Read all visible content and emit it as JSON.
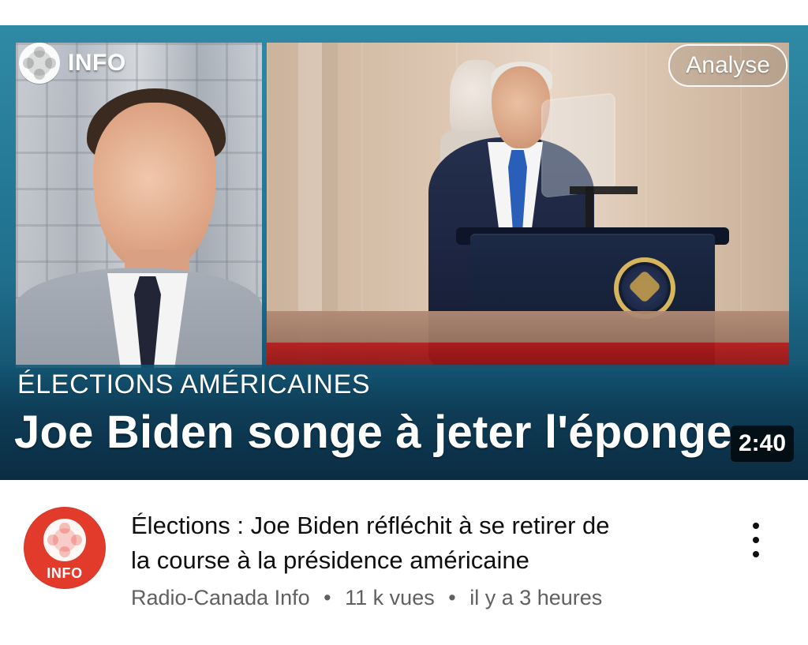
{
  "thumbnail": {
    "brand_text": "INFO",
    "badge_text": "Analyse",
    "kicker_text": "ÉLECTIONS AMÉRICAINES",
    "headline_text": "Joe Biden songe à jeter l'éponge",
    "duration_text": "2:40",
    "colors": {
      "background": "#1f6f8d",
      "band": "#0f3b54"
    }
  },
  "video": {
    "title_line_1": "Élections : Joe Biden réfléchit à se retirer de",
    "title_line_2": "la course à la présidence américaine",
    "channel_name": "Radio-Canada Info",
    "separator": "•",
    "views": "11 k vues",
    "published": "il y a 3 heures",
    "more_icon": "more-vertical-icon"
  },
  "channel_avatar": {
    "text": "INFO",
    "color": "#e23b2b"
  }
}
